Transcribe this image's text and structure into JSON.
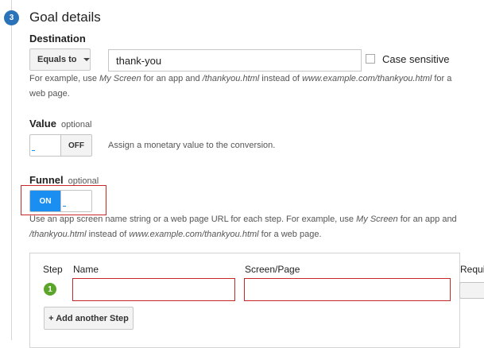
{
  "section": {
    "step_number": "3",
    "title": "Goal details"
  },
  "destination": {
    "label": "Destination",
    "match_type": "Equals to",
    "value": "thank-you",
    "case_sensitive_label": "Case sensitive",
    "case_sensitive_checked": false,
    "help": {
      "p1": "For example, use ",
      "i1": "My Screen",
      "p2": " for an app and ",
      "i2": "/thankyou.html",
      "p3": " instead of ",
      "i3": "www.example.com/thankyou.html",
      "p4": " for a",
      "line2": "web page."
    }
  },
  "value_section": {
    "label": "Value",
    "optional": "optional",
    "toggle_state": "OFF",
    "description": "Assign a monetary value to the conversion."
  },
  "funnel": {
    "label": "Funnel",
    "optional": "optional",
    "toggle_state": "ON",
    "help": {
      "p1": "Use an app screen name string or a web page URL for each step. For example, use ",
      "i1": "My Screen",
      "p2": " for an app and",
      "i2": "/thankyou.html",
      "p3": " instead of ",
      "i3": "www.example.com/thankyou.html",
      "p4": " for a web page."
    }
  },
  "steps_table": {
    "headers": {
      "step": "Step",
      "name": "Name",
      "screen_page": "Screen/Page",
      "required": "Requi"
    },
    "rows": [
      {
        "step": "1",
        "name": "",
        "screen_page": ""
      }
    ],
    "add_step_label": "+ Add another Step"
  },
  "colors": {
    "accent_blue": "#1a8ef1",
    "step_circle": "#2a73b8",
    "step_green": "#5aa52a",
    "error_red": "#c62828"
  }
}
